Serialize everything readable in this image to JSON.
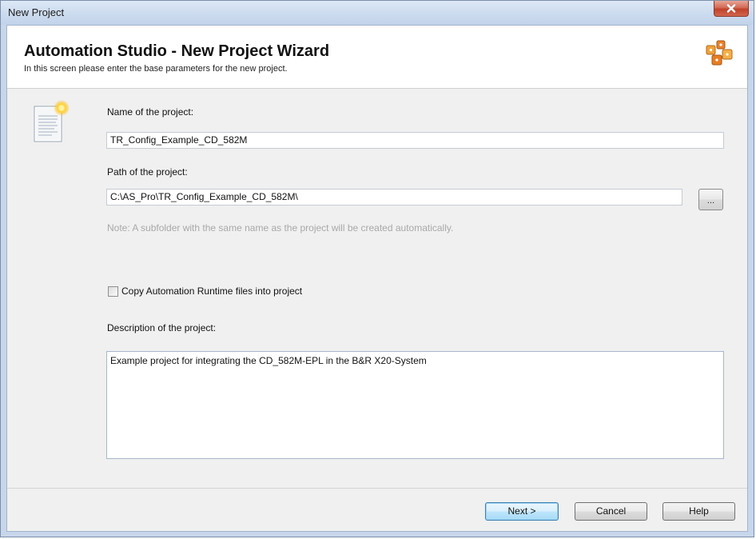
{
  "window": {
    "title": "New Project"
  },
  "header": {
    "title": "Automation Studio - New Project Wizard",
    "subtitle": "In this screen please enter the base parameters for the new project.",
    "logo_icon": "automation-studio-logo-icon"
  },
  "form": {
    "name_label": "Name of the project:",
    "name_value": "TR_Config_Example_CD_582M",
    "path_label": "Path of the project:",
    "path_value": "C:\\AS_Pro\\TR_Config_Example_CD_582M\\",
    "browse_label": "...",
    "note": "Note: A subfolder with the same name as the project will be created automatically.",
    "copy_runtime_label": "Copy Automation Runtime files into project",
    "copy_runtime_checked": false,
    "description_label": "Description of the project:",
    "description_value": "Example project for integrating the CD_582M-EPL in the B&R X20-System"
  },
  "buttons": {
    "next": "Next >",
    "cancel": "Cancel",
    "help": "Help"
  },
  "icons": {
    "close": "close-icon",
    "document": "new-document-icon"
  },
  "colors": {
    "accent": "#3c7fb1",
    "close_button": "#c0412a",
    "note_text": "#a8a8a8"
  }
}
